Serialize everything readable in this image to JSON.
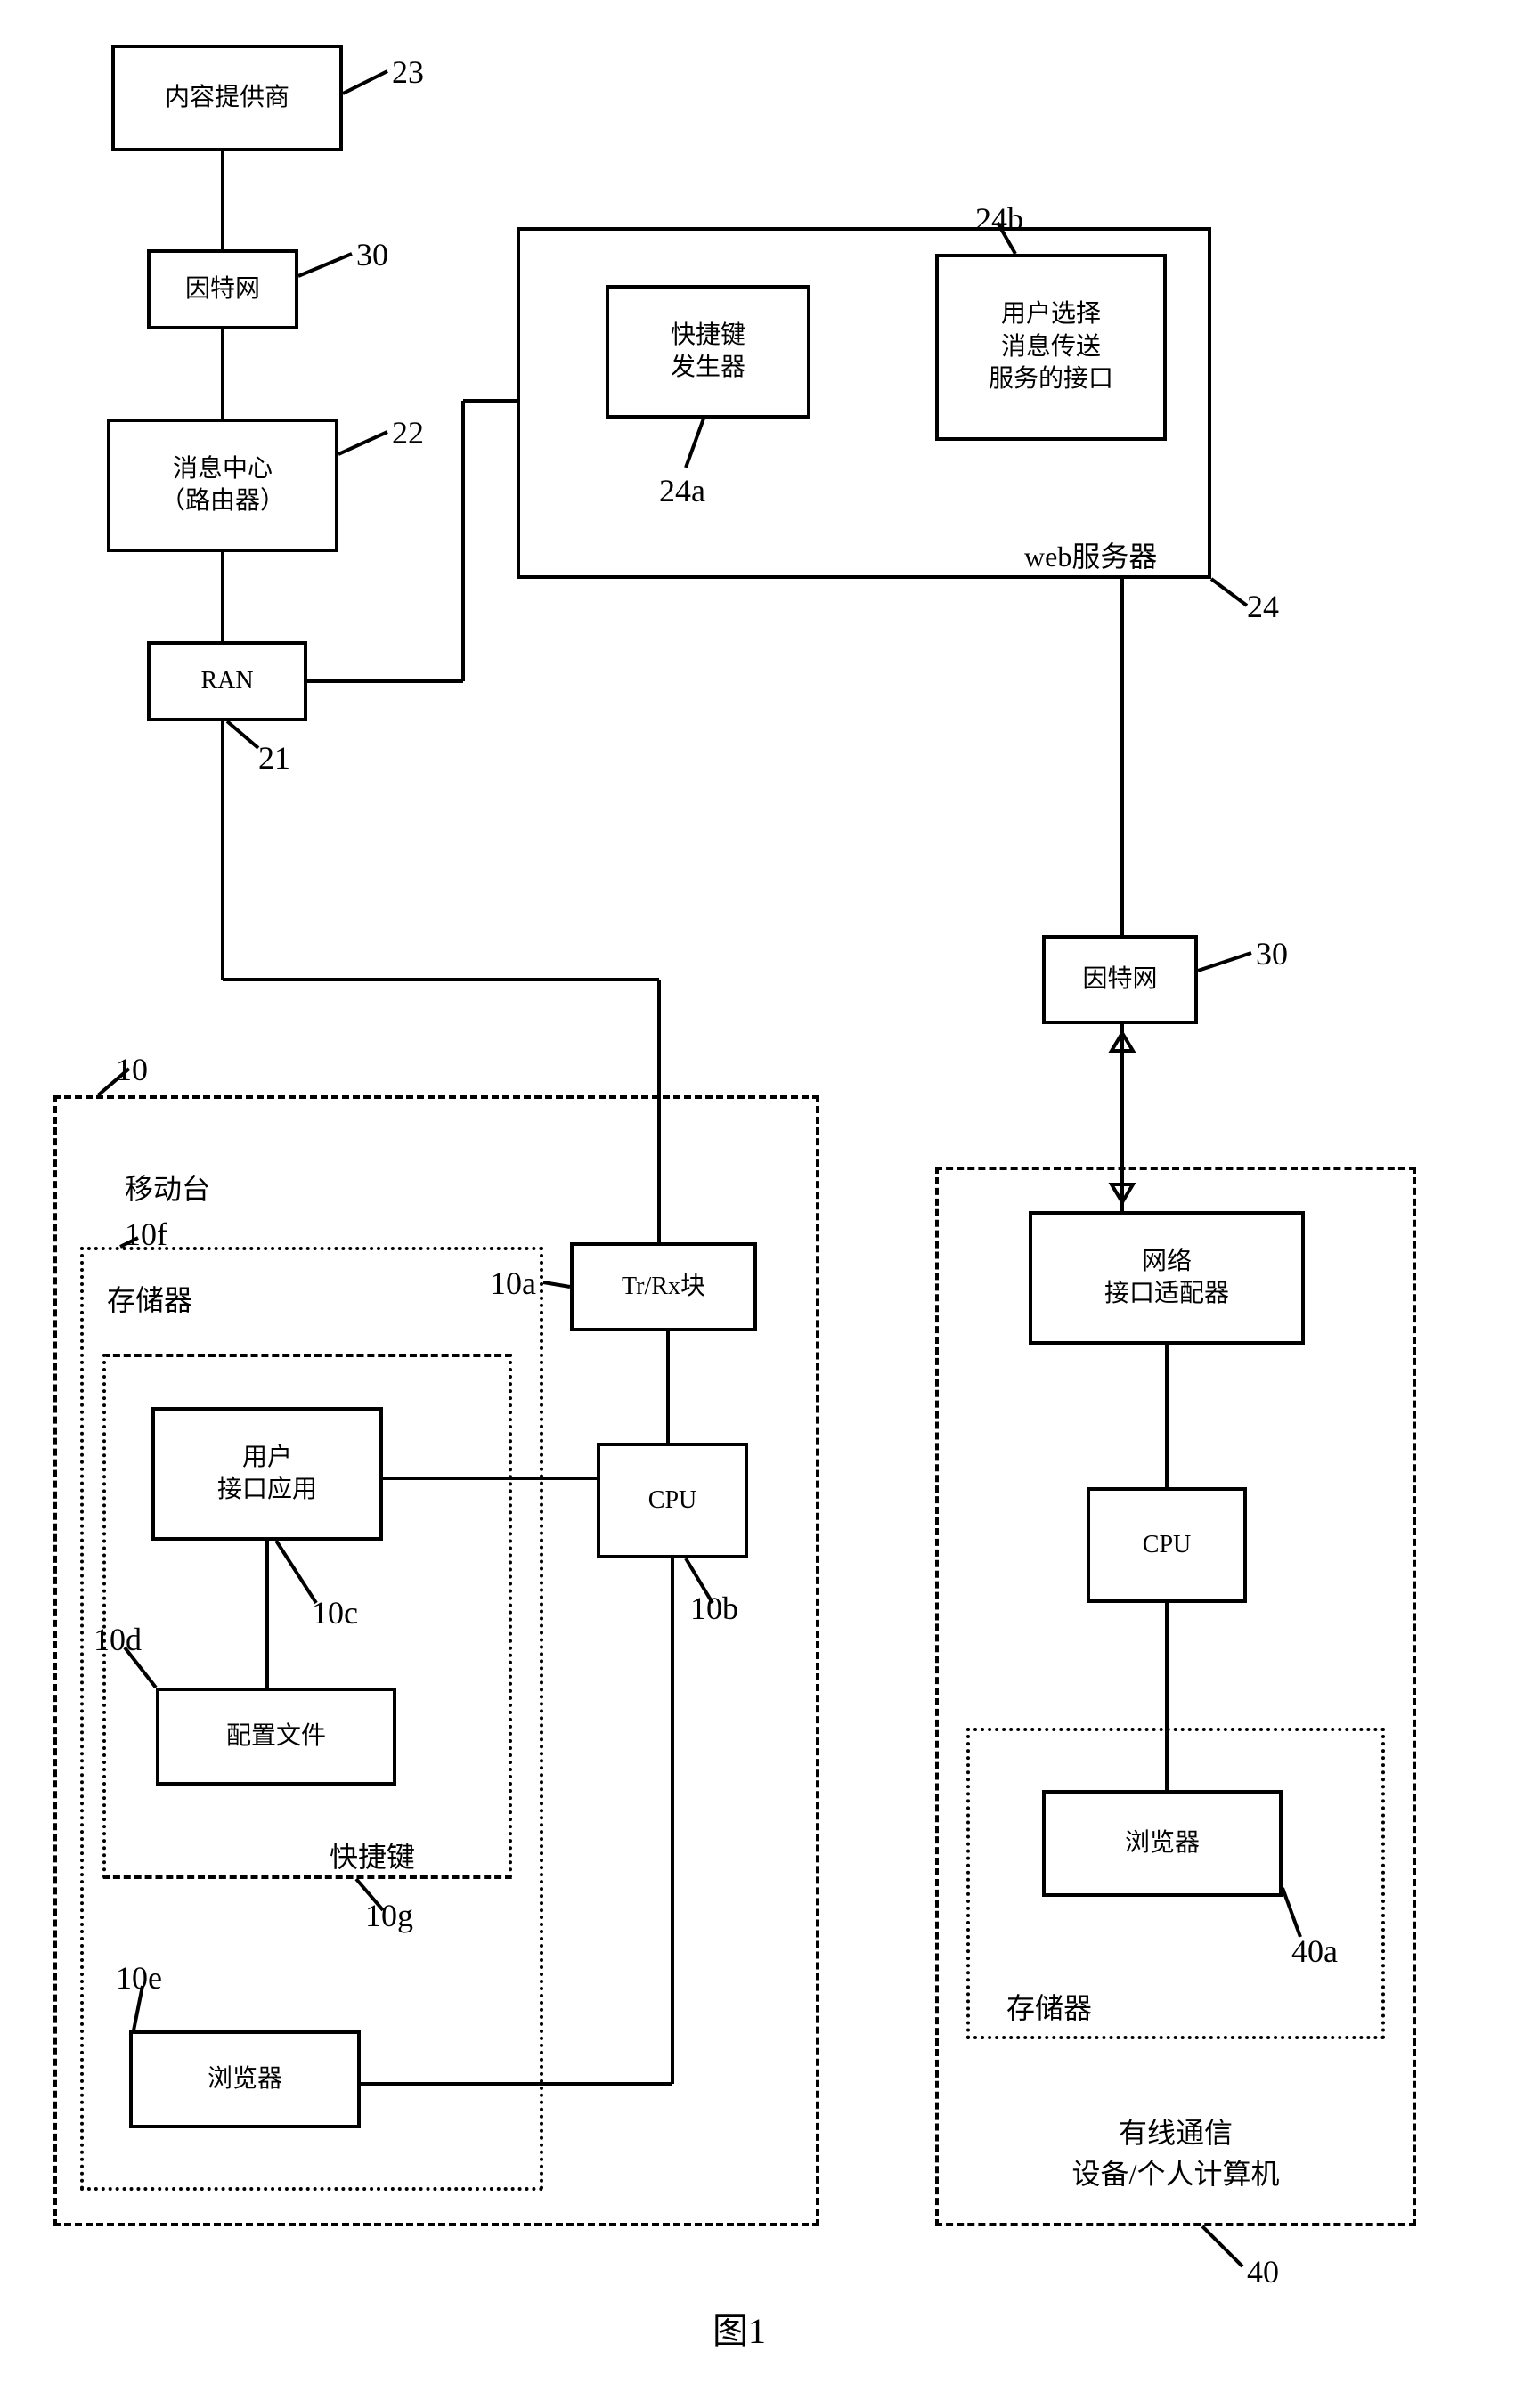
{
  "nodes": {
    "content_provider": "内容提供商",
    "internet_top": "因特网",
    "message_center_line1": "消息中心",
    "message_center_line2": "（路由器）",
    "ran": "RAN",
    "shortcut_generator_line1": "快捷键",
    "shortcut_generator_line2": "发生器",
    "user_select_line1": "用户选择",
    "user_select_line2": "消息传送",
    "user_select_line3": "服务的接口",
    "web_server_label": "web服务器",
    "internet_right": "因特网",
    "trrx": "Tr/Rx块",
    "cpu_left": "CPU",
    "user_interface_app_line1": "用户",
    "user_interface_app_line2": "接口应用",
    "config_file": "配置文件",
    "browser_left": "浏览器",
    "memory_left_label": "存储器",
    "shortcut_label": "快捷键",
    "mobile_station_label": "移动台",
    "network_adapter_line1": "网络",
    "network_adapter_line2": "接口适配器",
    "cpu_right": "CPU",
    "browser_right": "浏览器",
    "memory_right_label": "存储器",
    "wired_device_line1": "有线通信",
    "wired_device_line2": "设备/个人计算机"
  },
  "labels": {
    "n23": "23",
    "n30_top": "30",
    "n22": "22",
    "n21": "21",
    "n24a": "24a",
    "n24b": "24b",
    "n24": "24",
    "n30_right": "30",
    "n10": "10",
    "n10a": "10a",
    "n10b": "10b",
    "n10c": "10c",
    "n10d": "10d",
    "n10e": "10e",
    "n10f": "10f",
    "n10g": "10g",
    "n40": "40",
    "n40a": "40a"
  },
  "caption": "图1"
}
